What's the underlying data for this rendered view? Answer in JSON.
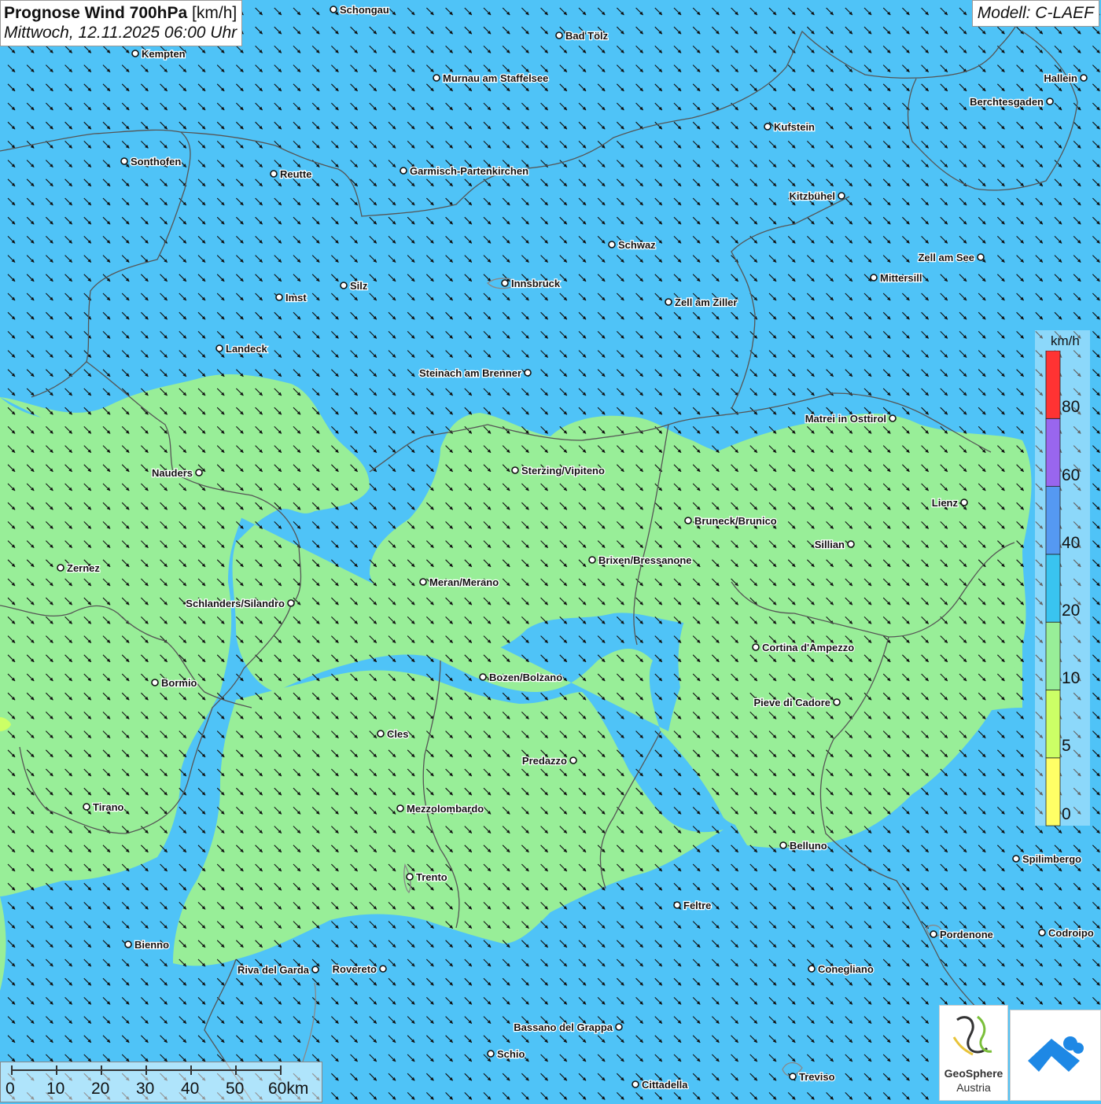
{
  "header": {
    "title_bold": "Prognose Wind 700hPa",
    "title_unit": "[km/h]",
    "subtitle": "Mittwoch, 12.11.2025 06:00 Uhr",
    "model": "Modell: C-LAEF"
  },
  "legend": {
    "unit": "km/h",
    "labels": [
      "80",
      "60",
      "40",
      "20",
      "10",
      "5",
      "0"
    ],
    "classes": [
      {
        "color": "#ffff66"
      },
      {
        "color": "#ccff66"
      },
      {
        "color": "#98ee98"
      },
      {
        "color": "#39c4f0"
      },
      {
        "color": "#5599f2"
      },
      {
        "color": "#9966ee"
      },
      {
        "color": "#ff3333"
      }
    ]
  },
  "colors": {
    "band_10_20": "#98ee98",
    "band_20_40": "#4fc3f7",
    "band_5_10": "#ccff66",
    "border": "#555555"
  },
  "wind": {
    "direction": "from north-west",
    "arrow_icon": "arrow-southeast-icon"
  },
  "cities": [
    {
      "name": "Schongau"
    },
    {
      "name": "Bad Tölz"
    },
    {
      "name": "Kempten"
    },
    {
      "name": "Murnau am Staffelsee"
    },
    {
      "name": "Hallein"
    },
    {
      "name": "Berchtesgaden"
    },
    {
      "name": "Kufstein"
    },
    {
      "name": "Sonthofen"
    },
    {
      "name": "Reutte"
    },
    {
      "name": "Garmisch-Partenkirchen"
    },
    {
      "name": "Kitzbühel"
    },
    {
      "name": "Schwaz"
    },
    {
      "name": "Zell am See"
    },
    {
      "name": "Mittersill"
    },
    {
      "name": "Innsbruck"
    },
    {
      "name": "Silz"
    },
    {
      "name": "Imst"
    },
    {
      "name": "Zell am Ziller"
    },
    {
      "name": "Landeck"
    },
    {
      "name": "Steinach am Brenner"
    },
    {
      "name": "Matrei in Osttirol"
    },
    {
      "name": "Nauders"
    },
    {
      "name": "Sterzing/Vipiteno"
    },
    {
      "name": "Lienz"
    },
    {
      "name": "Bruneck/Brunico"
    },
    {
      "name": "Sillian"
    },
    {
      "name": "Zernez"
    },
    {
      "name": "Brixen/Bressanone"
    },
    {
      "name": "Meran/Merano"
    },
    {
      "name": "Schlanders/Silandro"
    },
    {
      "name": "Cortina d'Ampezzo"
    },
    {
      "name": "Bozen/Bolzano"
    },
    {
      "name": "Bormio"
    },
    {
      "name": "Pieve di Cadore"
    },
    {
      "name": "Cles"
    },
    {
      "name": "Predazzo"
    },
    {
      "name": "Tirano"
    },
    {
      "name": "Mezzolombardo"
    },
    {
      "name": "Belluno"
    },
    {
      "name": "Spilimbergo"
    },
    {
      "name": "Trento"
    },
    {
      "name": "Feltre"
    },
    {
      "name": "Pordenone"
    },
    {
      "name": "Codroipo"
    },
    {
      "name": "Bienno"
    },
    {
      "name": "Riva del Garda"
    },
    {
      "name": "Rovereto"
    },
    {
      "name": "Conegliano"
    },
    {
      "name": "Bassano del Grappa"
    },
    {
      "name": "Schio"
    },
    {
      "name": "Treviso"
    },
    {
      "name": "Cittadella"
    }
  ],
  "scale": {
    "labels": [
      "0",
      "10",
      "20",
      "30",
      "40",
      "50",
      "60km"
    ]
  },
  "logos": {
    "geosphere_line1": "GeoSphere",
    "geosphere_line2": "Austria"
  }
}
